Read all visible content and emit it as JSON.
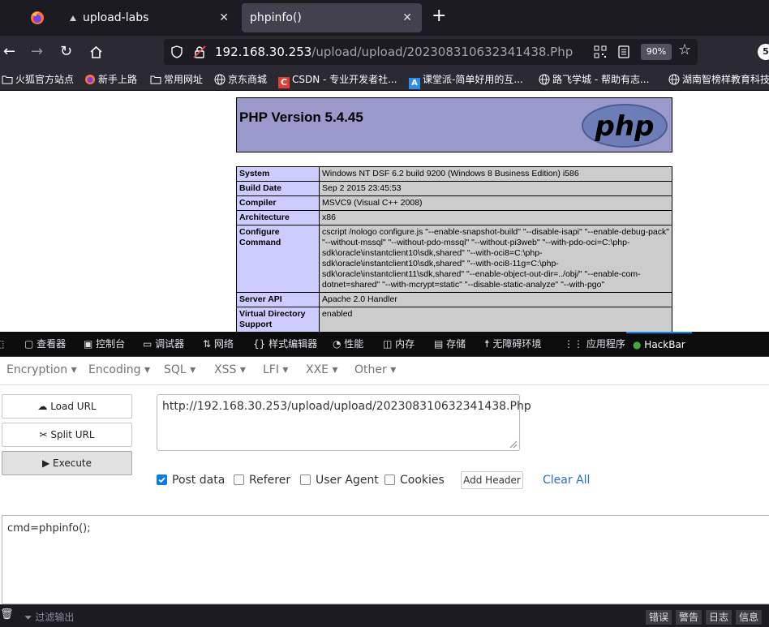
{
  "browser": {
    "tabs": [
      {
        "label": "upload-labs",
        "active": false
      },
      {
        "label": "phpinfo()",
        "active": true
      }
    ],
    "url": {
      "host": "192.168.30.253",
      "path": "/upload/upload/202308310632341438.Php"
    },
    "zoom": "90%",
    "badge": "5"
  },
  "bookmarks": [
    {
      "label": "火狐官方站点",
      "icon": "folder-icon"
    },
    {
      "label": "新手上路",
      "icon": "firefox-icon"
    },
    {
      "label": "常用网址",
      "icon": "folder-icon"
    },
    {
      "label": "京东商城",
      "icon": "globe-icon"
    },
    {
      "label": "CSDN - 专业开发者社...",
      "icon": "csdn-icon"
    },
    {
      "label": "课堂派-简单好用的互...",
      "icon": "ketangpai-icon"
    },
    {
      "label": "路飞学城 - 帮助有志...",
      "icon": "globe-icon"
    },
    {
      "label": "湖南智榜样教育科技",
      "icon": "globe-icon"
    }
  ],
  "phpinfo": {
    "version": "PHP Version 5.4.45",
    "logo": "php",
    "rows": [
      {
        "key": "System",
        "value": "Windows NT DSF 6.2 build 9200 (Windows 8 Business Edition) i586"
      },
      {
        "key": "Build Date",
        "value": "Sep 2 2015 23:45:53"
      },
      {
        "key": "Compiler",
        "value": "MSVC9 (Visual C++ 2008)"
      },
      {
        "key": "Architecture",
        "value": "x86"
      },
      {
        "key": "Configure Command",
        "value": "cscript /nologo configure.js \"--enable-snapshot-build\" \"--disable-isapi\" \"--enable-debug-pack\" \"--without-mssql\" \"--without-pdo-mssql\" \"--without-pi3web\" \"--with-pdo-oci=C:\\php-sdk\\oracle\\instantclient10\\sdk,shared\" \"--with-oci8=C:\\php-sdk\\oracle\\instantclient10\\sdk,shared\" \"--with-oci8-11g=C:\\php-sdk\\oracle\\instantclient11\\sdk,shared\" \"--enable-object-out-dir=../obj/\" \"--enable-com-dotnet=shared\" \"--with-mcrypt=static\" \"--disable-static-analyze\" \"--with-pgo\""
      },
      {
        "key": "Server API",
        "value": "Apache 2.0 Handler"
      },
      {
        "key": "Virtual Directory Support",
        "value": "enabled"
      }
    ]
  },
  "devtools": {
    "tabs": [
      {
        "label": "查看器",
        "icon": "inspector-icon"
      },
      {
        "label": "控制台",
        "icon": "console-icon"
      },
      {
        "label": "调试器",
        "icon": "debugger-icon"
      },
      {
        "label": "网络",
        "icon": "network-icon"
      },
      {
        "label": "样式编辑器",
        "icon": "style-editor-icon"
      },
      {
        "label": "性能",
        "icon": "performance-icon"
      },
      {
        "label": "内存",
        "icon": "memory-icon"
      },
      {
        "label": "存储",
        "icon": "storage-icon"
      },
      {
        "label": "无障碍环境",
        "icon": "accessibility-icon"
      },
      {
        "label": "应用程序",
        "icon": "application-icon"
      },
      {
        "label": "HackBar",
        "icon": "hackbar-icon",
        "active": true
      }
    ]
  },
  "hackbar": {
    "menu": [
      "Encryption",
      "Encoding",
      "SQL",
      "XSS",
      "LFI",
      "XXE",
      "Other"
    ],
    "buttons": {
      "load": "Load URL",
      "split": "Split URL",
      "execute": "Execute"
    },
    "url_value": "http://192.168.30.253/upload/upload/202308310632341438.Php",
    "options": [
      {
        "label": "Post data",
        "checked": true
      },
      {
        "label": "Referer",
        "checked": false
      },
      {
        "label": "User Agent",
        "checked": false
      },
      {
        "label": "Cookies",
        "checked": false
      }
    ],
    "add_header": "Add Header",
    "clear_all": "Clear All",
    "post_value": "cmd=phpinfo();"
  },
  "console": {
    "filter_placeholder": "过滤输出",
    "buttons": [
      "错误",
      "警告",
      "日志",
      "信息"
    ]
  },
  "colors": {
    "accent": "#0a84ff",
    "php_header": "#9999cc",
    "php_key": "#ccccff",
    "php_value": "#cccccc",
    "hackbar_link": "#2a6bd4"
  }
}
